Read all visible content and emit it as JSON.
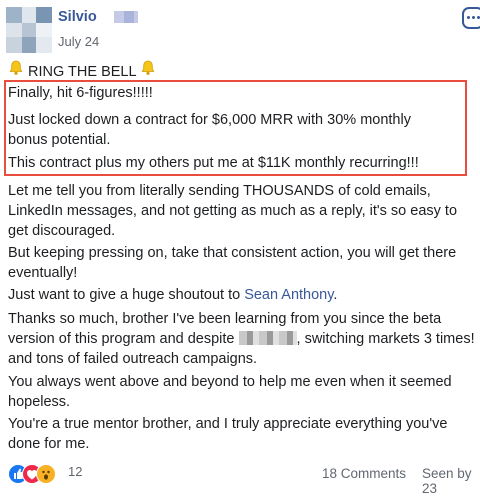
{
  "post": {
    "author": "Silvio",
    "date": "July 24",
    "title": "RING THE BELL",
    "highlight_lines": [
      "Finally, hit 6-figures!!!!!",
      "Just locked down a contract for $6,000 MRR with 30% monthly bonus potential.",
      "This contract plus my others put me at $11K monthly recurring!!!"
    ],
    "paragraphs": [
      "Let me tell you from literally sending THOUSANDS of cold emails, LinkedIn messages, and not getting as much as a reply, it's so easy to get discouraged.",
      "But keeping pressing on, take that consistent action, you will get there eventually!"
    ],
    "shoutout_prefix": "Just want to give a huge shoutout to ",
    "shoutout_link": "Sean Anthony",
    "shoutout_suffix": ".",
    "thanks_before": "Thanks so much, brother I've been learning from you since the beta version of this program and despite ",
    "thanks_after": ", switching markets 3 times! and tons of failed outreach campaigns.",
    "paragraphs_end": [
      "You always went above and beyond to help me even when it seemed hopeless.",
      "You're a true mentor brother, and I truly appreciate everything you've done for me."
    ]
  },
  "footer": {
    "reaction_count": "12",
    "comments": "18 Comments",
    "seen": "Seen by 23"
  },
  "colors": {
    "link": "#385898",
    "highlight_border": "#e84d3d",
    "text": "#1c1e21",
    "muted": "#616770"
  },
  "icons": [
    "bell-icon",
    "more-options-icon",
    "like-reaction-icon",
    "love-reaction-icon",
    "wow-reaction-icon"
  ]
}
